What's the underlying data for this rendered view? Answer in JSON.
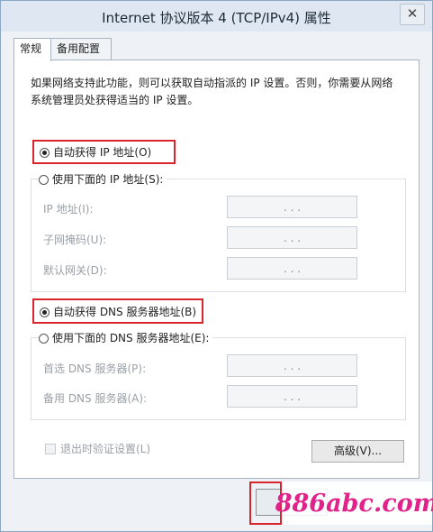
{
  "window": {
    "title": "Internet 协议版本 4 (TCP/IPv4) 属性",
    "close_glyph": "✕"
  },
  "tabs": [
    {
      "label": "常规"
    },
    {
      "label": "备用配置"
    }
  ],
  "general": {
    "description": "如果网络支持此功能，则可以获取自动指派的 IP 设置。否则，你需要从网络系统管理员处获得适当的 IP 设置。",
    "auto_ip_label": "自动获得 IP 地址(O)",
    "manual_ip_label": "使用下面的 IP 地址(S):",
    "ip_fields": [
      {
        "label": "IP 地址(I):",
        "value": ". . ."
      },
      {
        "label": "子网掩码(U):",
        "value": ". . ."
      },
      {
        "label": "默认网关(D):",
        "value": ". . ."
      }
    ],
    "auto_dns_label": "自动获得 DNS 服务器地址(B)",
    "manual_dns_label": "使用下面的 DNS 服务器地址(E):",
    "dns_fields": [
      {
        "label": "首选 DNS 服务器(P):",
        "value": ". . ."
      },
      {
        "label": "备用 DNS 服务器(A):",
        "value": ". . ."
      }
    ],
    "validate_label": "退出时验证设置(L)",
    "advanced_label": "高级(V)..."
  },
  "watermark": "886abc.com",
  "colors": {
    "highlight": "#d9262c",
    "watermark": "#e0228a"
  }
}
